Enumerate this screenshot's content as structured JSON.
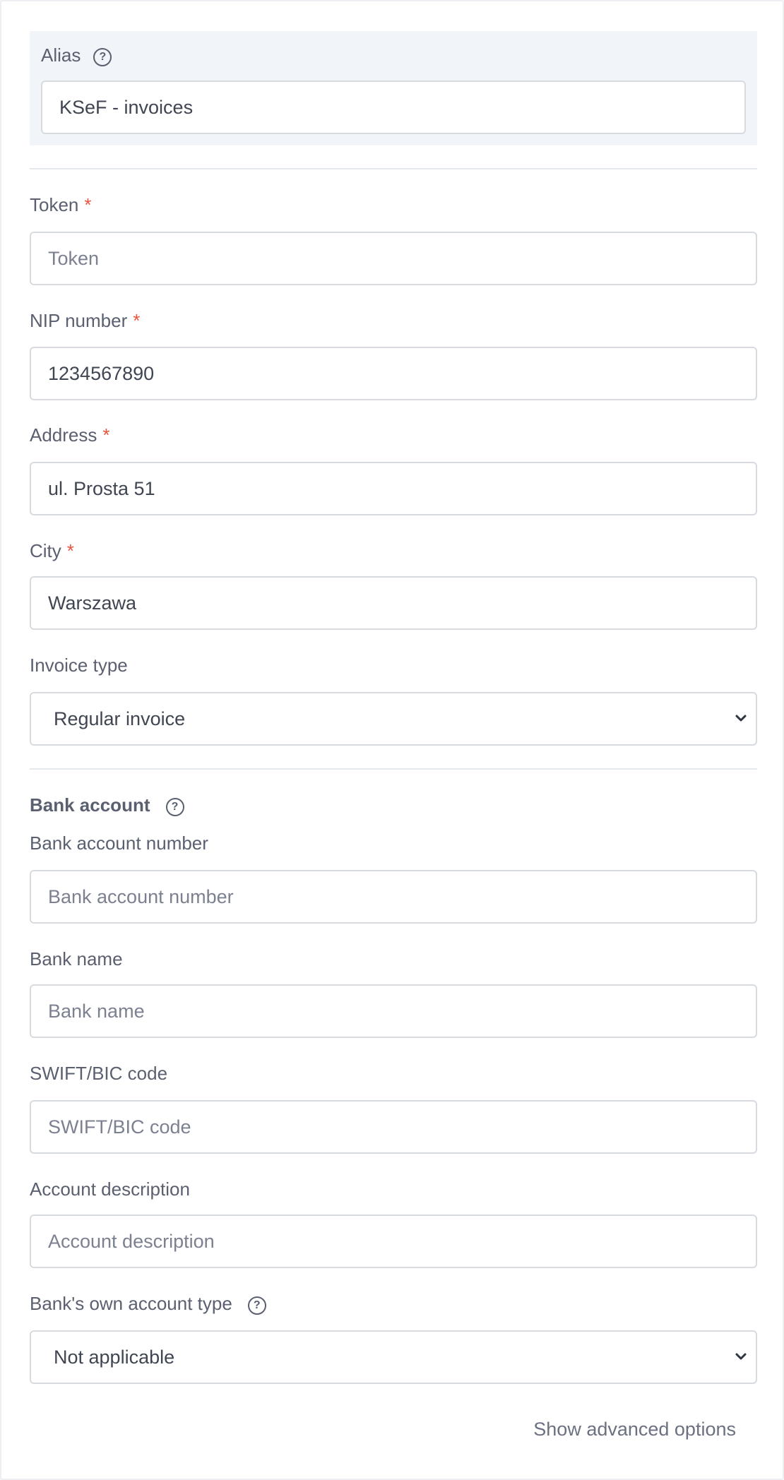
{
  "alias": {
    "label": "Alias",
    "value": "KSeF - invoices"
  },
  "token": {
    "label": "Token",
    "required_mark": "*",
    "value": "",
    "placeholder": "Token"
  },
  "nip": {
    "label": "NIP number",
    "required_mark": "*",
    "value": "1234567890"
  },
  "address": {
    "label": "Address",
    "required_mark": "*",
    "value": "ul. Prosta 51"
  },
  "city": {
    "label": "City",
    "required_mark": "*",
    "value": "Warszawa"
  },
  "invoice_type": {
    "label": "Invoice type",
    "selected": "Regular invoice"
  },
  "bank_account": {
    "section_title": "Bank account",
    "account_number": {
      "label": "Bank account number",
      "placeholder": "Bank account number"
    },
    "bank_name": {
      "label": "Bank name",
      "placeholder": "Bank name"
    },
    "swift": {
      "label": "SWIFT/BIC code",
      "placeholder": "SWIFT/BIC code"
    },
    "description": {
      "label": "Account description",
      "placeholder": "Account description"
    },
    "own_account_type": {
      "label": "Bank's own account type",
      "selected": "Not applicable"
    }
  },
  "advanced_link": "Show advanced options",
  "icons": {
    "help": "help-circle-icon",
    "dropdown": "chevron-down-icon"
  },
  "colors": {
    "required": "#e8553e",
    "alias_background": "#f1f4f8",
    "border": "#d7dbe0"
  }
}
